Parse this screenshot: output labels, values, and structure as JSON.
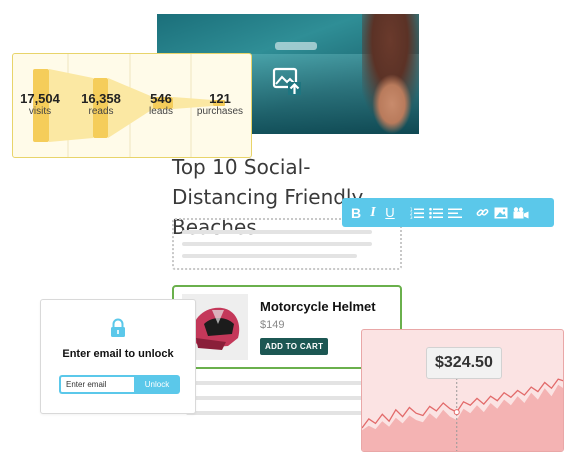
{
  "funnel": {
    "stages": [
      {
        "value": "17,504",
        "label": "visits"
      },
      {
        "value": "16,358",
        "label": "reads"
      },
      {
        "value": "546",
        "label": "leads"
      },
      {
        "value": "121",
        "label": "purchases"
      }
    ],
    "colors": {
      "bar": "#f5cd5a",
      "band": "#fbe8a3",
      "border": "#e8d46a",
      "background": "#fffbe9"
    }
  },
  "hero": {
    "icon": "image-upload-icon"
  },
  "article": {
    "title": "Top 10 Social-Distancing Friendly Beaches"
  },
  "toolbar": {
    "buttons": [
      "bold-icon",
      "italic-icon",
      "underline-icon",
      "ordered-list-icon",
      "bullet-list-icon",
      "align-icon",
      "link-icon",
      "image-icon",
      "video-icon"
    ],
    "bold_label": "B",
    "italic_label": "I",
    "underline_label": "U",
    "color": "#5bc8ea"
  },
  "product": {
    "name": "Motorcycle Helmet",
    "price": "$149",
    "button_label": "ADD TO CART",
    "border_color": "#6ab04c",
    "button_color": "#1c5753"
  },
  "email_gate": {
    "title": "Enter email to unlock",
    "placeholder": "Enter email",
    "button_label": "Unlock",
    "accent": "#5bc8ea",
    "icon": "lock-icon"
  },
  "price_chart": {
    "price": "$324.50",
    "colors": {
      "area": "#f4b3b3",
      "line": "#e26a6a",
      "background": "#fbe3e3"
    },
    "chart_data": {
      "type": "area",
      "x": [
        0,
        1,
        2,
        3,
        4,
        5,
        6,
        7,
        8,
        9,
        10,
        11,
        12,
        13,
        14,
        15,
        16,
        17,
        18,
        19,
        20,
        21,
        22,
        23,
        24,
        25,
        26,
        27,
        28,
        29,
        30
      ],
      "series": [
        {
          "values": [
            22,
            30,
            26,
            34,
            28,
            38,
            32,
            40,
            35,
            33,
            41,
            37,
            44,
            39,
            36,
            45,
            42,
            48,
            43,
            50,
            46,
            53,
            49,
            55,
            51,
            58,
            54,
            62,
            57,
            65,
            63
          ]
        },
        {
          "values": [
            20,
            24,
            21,
            28,
            23,
            31,
            26,
            33,
            29,
            27,
            35,
            30,
            38,
            32,
            29,
            39,
            35,
            42,
            36,
            44,
            39,
            47,
            42,
            50,
            44,
            53,
            47,
            57,
            50,
            60,
            56
          ]
        }
      ],
      "highlight": {
        "x": 14,
        "value": "$324.50"
      }
    }
  }
}
